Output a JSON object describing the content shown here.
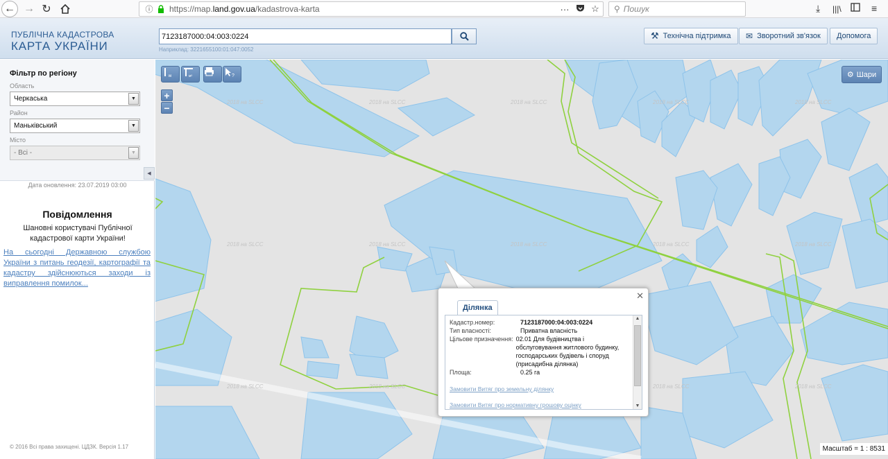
{
  "browser": {
    "url_prefix": "https://map.",
    "url_domain": "land.gov.ua",
    "url_path": "/kadastrova-karta",
    "search_placeholder": "Пошук"
  },
  "header": {
    "logo_line1": "ПУБЛІЧНА КАДАСТРОВА",
    "logo_line2": "КАРТА УКРАЇНИ",
    "search_value": "7123187000:04:003:0224",
    "example_text": "Наприклад: 3221655100:01:047:0052",
    "buttons": {
      "support": "Технічна підтримка",
      "feedback": "Зворотний зв'язок",
      "help": "Допомога"
    }
  },
  "sidebar": {
    "filter_title": "Фільтр по регіону",
    "region_label": "Область",
    "region_value": "Черкаська",
    "district_label": "Район",
    "district_value": "Маньківський",
    "city_label": "Місто",
    "city_value": "- Всі -",
    "updated": "Дата оновлення: 23.07.2019 03:00",
    "notice_title": "Повідомлення",
    "notice_text": "Шановні користувачі Публічної кадастрової карти України!",
    "notice_link": "На сьогодні Державною службою України з питань геодезії, картографії та кадастру здійснюються заходи із виправлення помилок...",
    "copyright": "© 2016 Всі права захищені. ЦДЗК. Версія 1.17"
  },
  "map": {
    "layers_label": "Шари",
    "watermark": "2018 на SLCC",
    "scale": "Масштаб = 1 : 8531",
    "colors": {
      "parcel_fill": "#b3d6ee",
      "parcel_stroke": "#8ec3ea",
      "boundary": "#8fd13f"
    }
  },
  "popup": {
    "tab": "Ділянка",
    "cad_label": "Кадастр.номер:",
    "cad_value": "7123187000:04:003:0224",
    "ownership_label": "Тип власності:",
    "ownership_value": "Приватна власність",
    "purpose_label": "Цільове призначення:",
    "purpose_value": "02.01 Для будівництва і обслуговування житлового будинку, господарських будівель і споруд (присадибна ділянка)",
    "area_label": "Площа:",
    "area_value": "0.25 га",
    "link1": "Замовити Витяг про земельну ділянку",
    "link2": "Замовити Витяг про нормативну грошову оцінку"
  }
}
